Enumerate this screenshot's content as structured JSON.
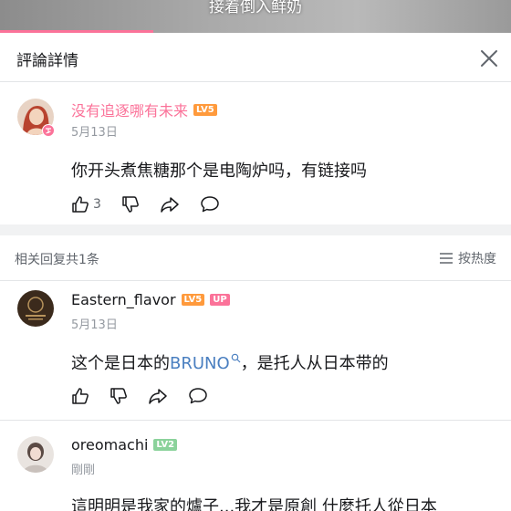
{
  "video": {
    "subtitle": "接着倒入鲜奶",
    "progress_fraction": 0.3
  },
  "header": {
    "title": "評論詳情",
    "close_icon": "close-icon"
  },
  "main_comment": {
    "username": "没有追逐哪有未来",
    "username_color": "#fb7299",
    "level": "LV5",
    "date": "5月13日",
    "content": "你开头煮焦糖那个是电陶炉吗，有链接吗",
    "like_count": "3"
  },
  "replies": {
    "count_label": "相关回复共1条",
    "sort_label": "按热度",
    "items": [
      {
        "username": "Eastern_flavor",
        "level": "LV5",
        "up_badge": "UP",
        "date": "5月13日",
        "content_before": "这个是日本的",
        "content_link": "BRUNO",
        "content_after": "，是托人从日本带的"
      },
      {
        "username": "oreomachi",
        "level": "LV2",
        "date": "剛剛",
        "content": "這明明是我家的爐子...我才是原創 什麼托人從日本"
      }
    ]
  },
  "colors": {
    "accent": "#fb7299",
    "lv5": "#ff9a3c",
    "lv2": "#8bd29b",
    "link": "#4a7fc0"
  }
}
